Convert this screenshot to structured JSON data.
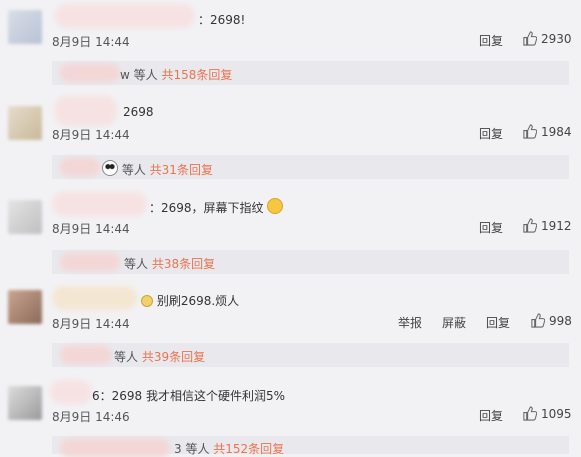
{
  "comments": [
    {
      "text": "：2698!",
      "time": "8月9日 14:44",
      "reply_label": "回复",
      "likes": "2930",
      "replies_summary": "w 等人",
      "replies_count": "共158条回复"
    },
    {
      "text": "2698",
      "time": "8月9日 14:44",
      "reply_label": "回复",
      "likes": "1984",
      "replies_summary": "等人",
      "replies_count": "共31条回复"
    },
    {
      "text": "：2698，屏幕下指纹",
      "time": "8月9日 14:44",
      "reply_label": "回复",
      "likes": "1912",
      "replies_summary": "等人",
      "replies_count": "共38条回复"
    },
    {
      "text": "别刷2698.烦人",
      "time": "8月9日 14:44",
      "report_label": "举报",
      "block_label": "屏蔽",
      "reply_label": "回复",
      "likes": "998",
      "replies_summary": "等人",
      "replies_count": "共39条回复"
    },
    {
      "text": "6：2698 我才相信这个硬件利润5%",
      "time": "8月9日 14:46",
      "reply_label": "回复",
      "likes": "1095",
      "replies_summary": "3 等人",
      "replies_count": "共152条回复"
    }
  ],
  "icons": {
    "like": "thumbs-up-icon",
    "emoji": "panda-emoji-icon",
    "emoji2": "laughing-emoji-icon"
  },
  "colors": {
    "reply_count": "#eb7350",
    "background": "#f2f2f5",
    "reply_bar": "#e9e9ed"
  }
}
